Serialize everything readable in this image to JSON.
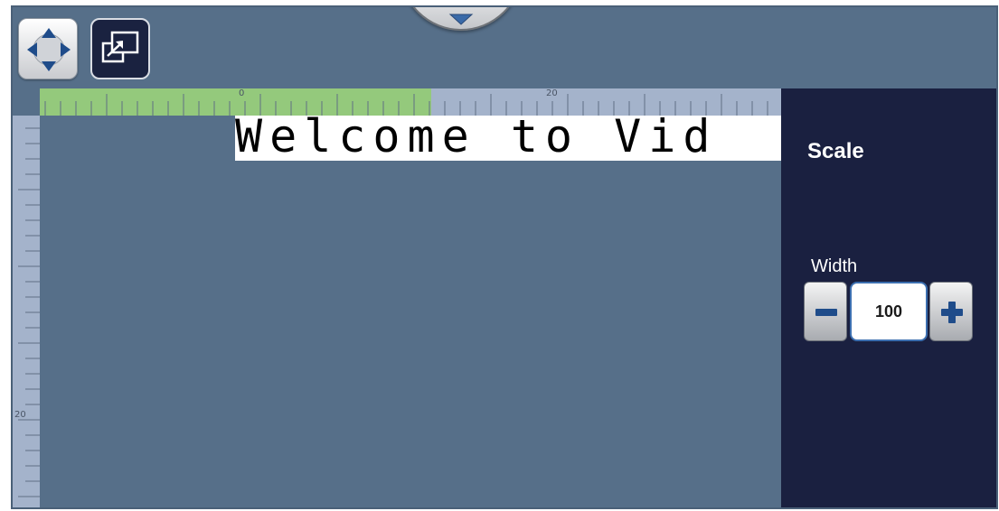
{
  "toolbar": {
    "move_icon": "move-arrows-icon",
    "scale_icon": "resize-scale-icon",
    "pulldown_icon": "chevron-down-icon"
  },
  "ruler": {
    "horizontal_labels": [
      "0",
      "20"
    ],
    "vertical_labels": [
      "20"
    ]
  },
  "canvas": {
    "text": "Welcome to Vid"
  },
  "scale_panel": {
    "title": "Scale",
    "width_label": "Width",
    "width_value": "100",
    "minus_icon": "minus-icon",
    "plus_icon": "plus-icon"
  },
  "colors": {
    "canvas_bg": "#566f89",
    "panel_bg": "#1a2040",
    "ruler_bg": "#a4b3cb",
    "ruler_selected": "#94c97c"
  }
}
